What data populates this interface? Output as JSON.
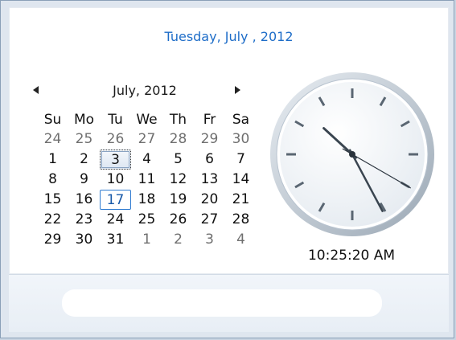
{
  "header": {
    "date_link": "Tuesday, July  , 2012"
  },
  "calendar": {
    "month_title": "July, 2012",
    "prev_icon": "triangle-left-icon",
    "next_icon": "triangle-right-icon",
    "weekdays": [
      "Su",
      "Mo",
      "Tu",
      "We",
      "Th",
      "Fr",
      "Sa"
    ],
    "weeks": [
      [
        "24",
        "25",
        "26",
        "27",
        "28",
        "29",
        "30"
      ],
      [
        "1",
        "2",
        "3",
        "4",
        "5",
        "6",
        "7"
      ],
      [
        "8",
        "9",
        "10",
        "11",
        "12",
        "13",
        "14"
      ],
      [
        "15",
        "16",
        "17",
        "18",
        "19",
        "20",
        "21"
      ],
      [
        "22",
        "23",
        "24",
        "25",
        "26",
        "27",
        "28"
      ],
      [
        "29",
        "30",
        "31",
        "1",
        "2",
        "3",
        "4"
      ]
    ],
    "selected_day": "3",
    "today_day": "17"
  },
  "clock": {
    "time_text": "10:25:20 AM",
    "hours": 10,
    "minutes": 25,
    "seconds": 20
  },
  "footer": {
    "link_text": ""
  },
  "colors": {
    "link": "#1e6dc8",
    "today_border": "#2e7bd1",
    "other_month": "#6f6f6f"
  }
}
